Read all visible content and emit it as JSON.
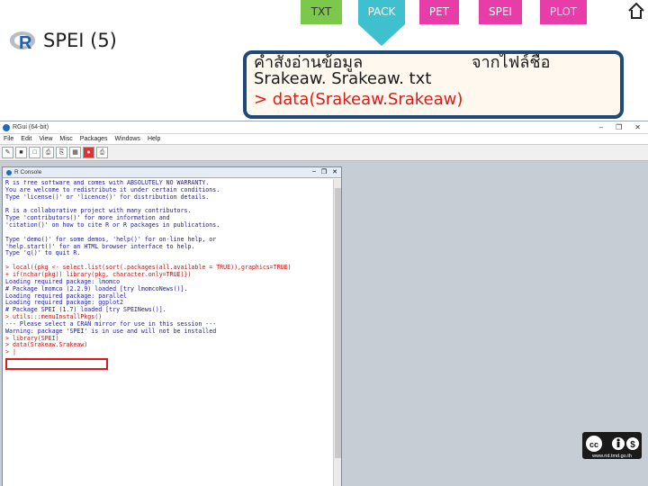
{
  "tabs": [
    "TXT",
    "PACK",
    "PET",
    "SPEI",
    "PLOT"
  ],
  "logo": {
    "title": "SPEI (5)"
  },
  "callout": {
    "line1": "คำสั่งอ่านข้อมูล",
    "line1b": "จากไฟล์ชื่อ",
    "line2": "Srakeaw. Srakeaw. txt",
    "line3": "> data(Srakeaw.Srakeaw)"
  },
  "rgui": {
    "title": "RGui (64-bit)",
    "menus": [
      "File",
      "Edit",
      "View",
      "Misc",
      "Packages",
      "Windows",
      "Help"
    ],
    "console_title": "R Console"
  },
  "console_lines": [
    {
      "t": "out",
      "text": "R is free software and comes with ABSOLUTELY NO WARRANTY."
    },
    {
      "t": "out",
      "text": "You are welcome to redistribute it under certain conditions."
    },
    {
      "t": "out",
      "text": "Type 'license()' or 'licence()' for distribution details."
    },
    {
      "t": "blank",
      "text": ""
    },
    {
      "t": "out",
      "text": "R is a collaborative project with many contributors."
    },
    {
      "t": "out",
      "text": "Type 'contributors()' for more information and"
    },
    {
      "t": "out",
      "text": "'citation()' on how to cite R or R packages in publications."
    },
    {
      "t": "blank",
      "text": ""
    },
    {
      "t": "out",
      "text": "Type 'demo()' for some demos, 'help()' for on-line help, or"
    },
    {
      "t": "out",
      "text": "'help.start()' for an HTML browser interface to help."
    },
    {
      "t": "out",
      "text": "Type 'q()' to quit R."
    },
    {
      "t": "blank",
      "text": ""
    },
    {
      "t": "in",
      "text": "> local({pkg <- select.list(sort(.packages(all.available = TRUE)),graphics=TRUE)"
    },
    {
      "t": "in",
      "text": "+ if(nchar(pkg)) library(pkg, character.only=TRUE)})"
    },
    {
      "t": "out",
      "text": "Loading required package: lmomco"
    },
    {
      "t": "out",
      "text": "# Package lmomco (2.2.9) loaded [try lmomcoNews()]."
    },
    {
      "t": "out",
      "text": "Loading required package: parallel"
    },
    {
      "t": "out",
      "text": "Loading required package: ggplot2"
    },
    {
      "t": "out",
      "text": "# Package SPEI (1.7) loaded [try SPEINews()]."
    },
    {
      "t": "in",
      "text": "> utils:::menuInstallPkgs()"
    },
    {
      "t": "out",
      "text": "--- Please select a CRAN mirror for use in this session ---"
    },
    {
      "t": "out",
      "text": "Warning: package 'SPEI' is in use and will not be installed"
    },
    {
      "t": "in",
      "text": "> library(SPEI)"
    },
    {
      "t": "in",
      "text": "> data(Srakeaw.Srakeaw)"
    },
    {
      "t": "in",
      "text": "> |"
    }
  ],
  "badge": {
    "site": "www.rid.tmd.go.th"
  }
}
